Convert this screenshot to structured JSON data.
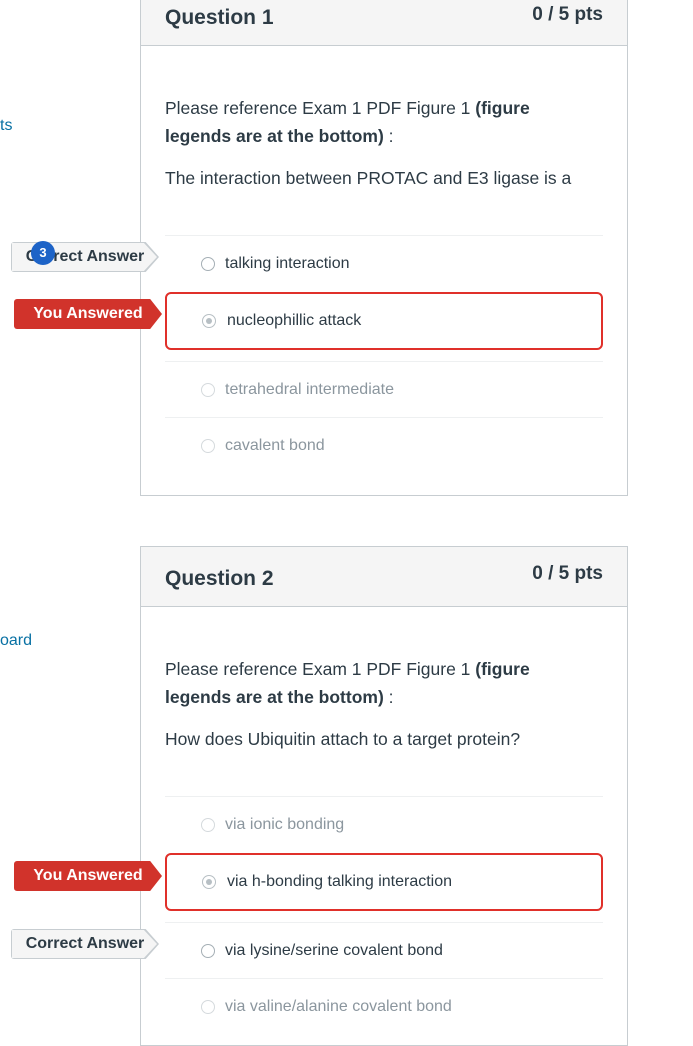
{
  "sidebar": {
    "link1_text": "ts",
    "link2_text": "oard"
  },
  "notification_badge": "3",
  "questions": [
    {
      "title": "Question 1",
      "points": "0 / 5 pts",
      "prompt_prefix": "Please reference Exam 1 PDF Figure 1 ",
      "prompt_bold": "(figure legends are at the bottom)",
      "prompt_suffix": " :",
      "question": "The interaction between PROTAC and E3 ligase is a",
      "answers": [
        "talking interaction",
        "nucleophillic attack",
        "tetrahedral intermediate",
        "cavalent bond"
      ],
      "correct_label": "Correct Answer",
      "wrong_label": "You Answered"
    },
    {
      "title": "Question 2",
      "points": "0 / 5 pts",
      "prompt_prefix": "Please reference Exam 1 PDF Figure 1 ",
      "prompt_bold": "(figure legends are at the bottom)",
      "prompt_suffix": " :",
      "question": "How does Ubiquitin attach to a target protein?",
      "answers": [
        "via ionic bonding",
        "via h-bonding talking interaction",
        "via lysine/serine covalent bond",
        "via valine/alanine covalent bond"
      ],
      "correct_label": "Correct Answer",
      "wrong_label": "You Answered"
    }
  ],
  "colors": {
    "link": "#0770a3",
    "wrong_flag": "#d1332b",
    "selected_border": "#e0302a",
    "badge": "#1d63c7"
  }
}
